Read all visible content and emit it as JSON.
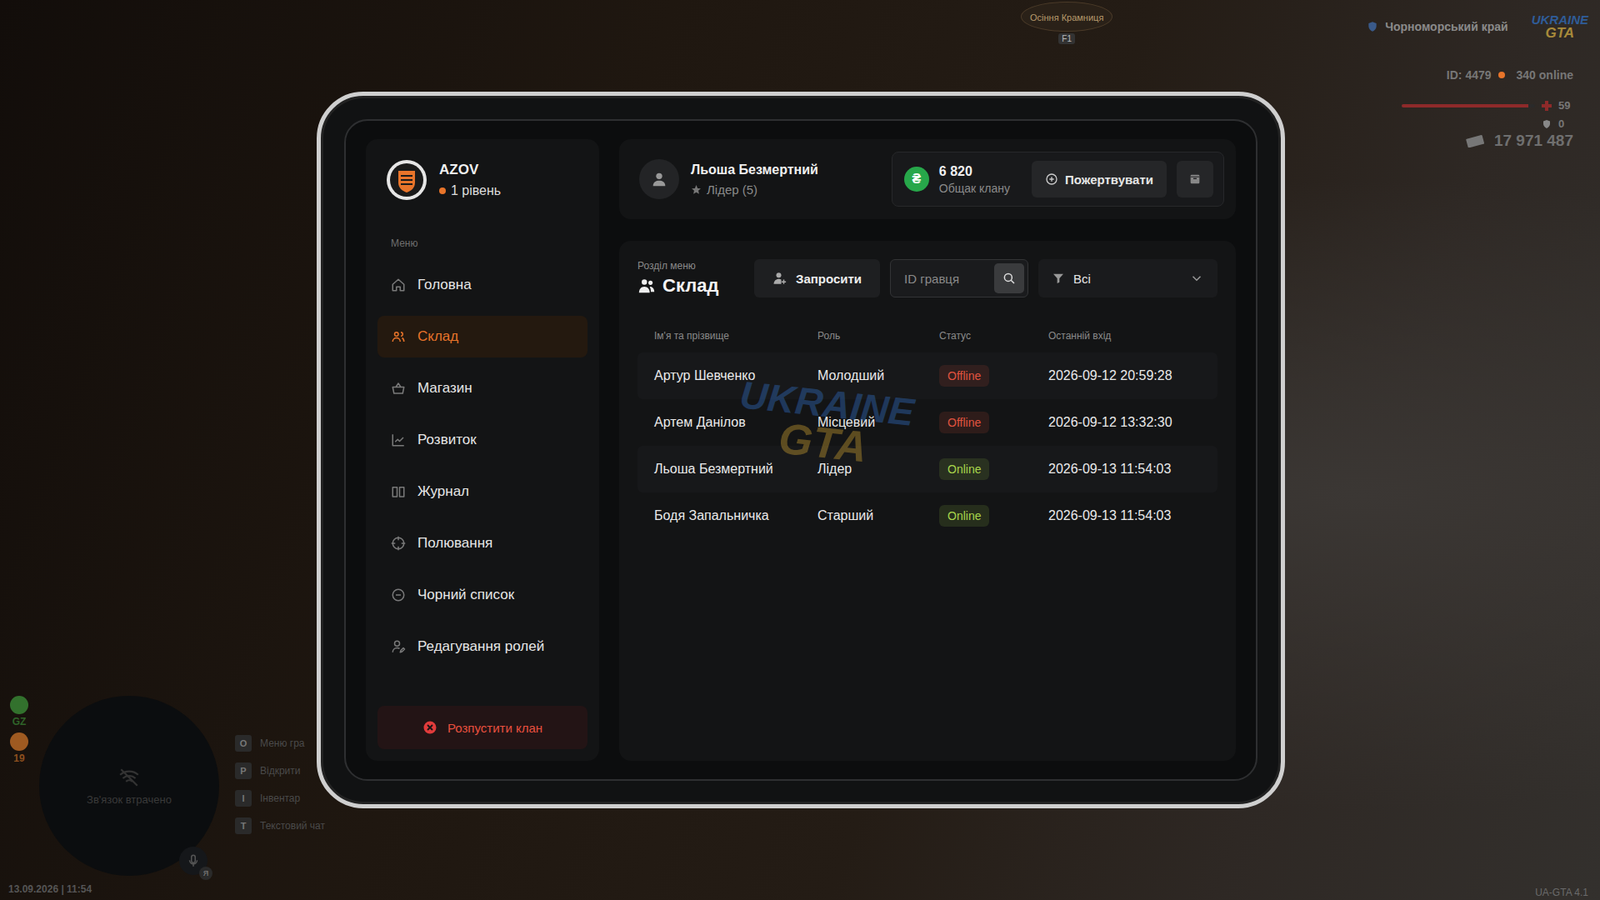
{
  "hud": {
    "region": "Чорноморський край",
    "logo": {
      "top": "UKRAINE",
      "bottom": "GTA"
    },
    "player_id": "ID: 4479",
    "online": "340 online",
    "health": {
      "value": "59",
      "level": 0.95
    },
    "armor": {
      "value": "0",
      "level": 0
    },
    "money": "17 971 487",
    "event": {
      "title": "Осіння Крамниця",
      "key": "F1"
    },
    "minimap": {
      "text": "Зв'язок втрачено"
    },
    "voice": {
      "key": "Я"
    },
    "indicators": [
      {
        "label": "GZ",
        "color": "#3f9a3c"
      },
      {
        "label": "19",
        "color": "#d9792b"
      }
    ],
    "hints": [
      {
        "key": "O",
        "label": "Меню гра"
      },
      {
        "key": "P",
        "label": "Відкрити"
      },
      {
        "key": "I",
        "label": "Інвентар"
      },
      {
        "key": "T",
        "label": "Текстовий чат"
      }
    ],
    "datetime": "13.09.2026 | 11:54",
    "version": "UA-GTA 4.1"
  },
  "watermark": {
    "top": "UKRAINE",
    "bottom": "GTA"
  },
  "clan": {
    "name": "AZOV",
    "level": "1 рівень"
  },
  "sidebar": {
    "label": "Меню",
    "items": [
      {
        "label": "Головна",
        "selected": false
      },
      {
        "label": "Склад",
        "selected": true
      },
      {
        "label": "Магазин",
        "selected": false
      },
      {
        "label": "Розвиток",
        "selected": false
      },
      {
        "label": "Журнал",
        "selected": false
      },
      {
        "label": "Полювання",
        "selected": false
      },
      {
        "label": "Чорний список",
        "selected": false
      },
      {
        "label": "Редагування ролей",
        "selected": false
      }
    ],
    "dissolve_button": "Розпустити клан"
  },
  "user": {
    "name": "Льоша Безмертний",
    "role": "Лідер (5)"
  },
  "treasury": {
    "currency_icon": "₴",
    "amount": "6 820",
    "label": "Общак клану",
    "donate_button": "Пожертвувати"
  },
  "section": {
    "caption": "Розділ меню",
    "title": "Склад",
    "invite_button": "Запросити",
    "search": {
      "placeholder": "ID гравця"
    },
    "filter": {
      "value": "Всі"
    }
  },
  "table": {
    "columns": [
      "Ім'я та прізвище",
      "Роль",
      "Статус",
      "Останній вхід"
    ],
    "rows": [
      {
        "name": "Артур Шевченко",
        "role": "Молодший",
        "status": "Offline",
        "color": "#e0533f",
        "last_login": "2026-09-12 20:59:28"
      },
      {
        "name": "Артем Данілов",
        "role": "Місцевий",
        "status": "Offline",
        "color": "#e0533f",
        "last_login": "2026-09-12 13:32:30"
      },
      {
        "name": "Льоша Безмертний",
        "role": "Лідер",
        "status": "Online",
        "color": "#a8d64b",
        "last_login": "2026-09-13 11:54:03"
      },
      {
        "name": "Бодя Запальничка",
        "role": "Старший",
        "status": "Online",
        "color": "#a8d64b",
        "last_login": "2026-09-13 11:54:03"
      }
    ]
  }
}
